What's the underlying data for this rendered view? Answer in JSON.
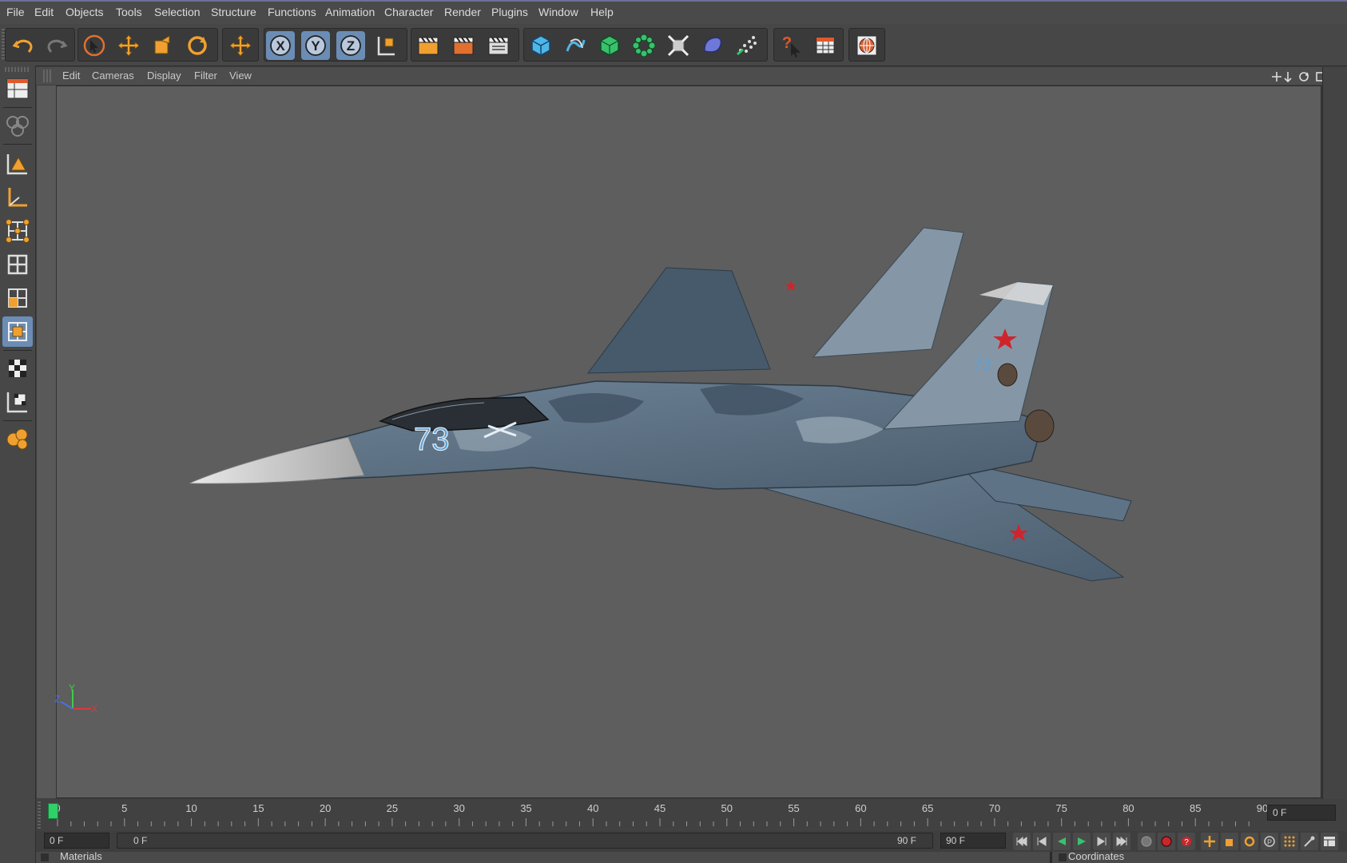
{
  "menu": [
    "File",
    "Edit",
    "Objects",
    "Tools",
    "Selection",
    "Structure",
    "Functions",
    "Animation",
    "Character",
    "Render",
    "Plugins",
    "Window",
    "Help"
  ],
  "viewport_menu": [
    "Edit",
    "Cameras",
    "Display",
    "Filter",
    "View"
  ],
  "fuselage_number": "73",
  "axis_labels": {
    "z": "Z",
    "y": "Y",
    "x": "X"
  },
  "timeline": {
    "ticks": [
      "0",
      "5",
      "10",
      "15",
      "20",
      "25",
      "30",
      "35",
      "40",
      "45",
      "50",
      "55",
      "60",
      "65",
      "70",
      "75",
      "80",
      "85",
      "90"
    ],
    "current_frame": "0 F",
    "start_frame": "0 F",
    "range_start": "0 F",
    "range_end": "90 F",
    "end_frame": "90 F"
  },
  "panels": {
    "materials": "Materials",
    "coordinates": "Coordinates"
  },
  "colors": {
    "accent_active": "#6b8db5",
    "playhead": "#2fd06a",
    "orange_icon": "#f0a030",
    "viewport_bg": "#5e5e5e"
  }
}
